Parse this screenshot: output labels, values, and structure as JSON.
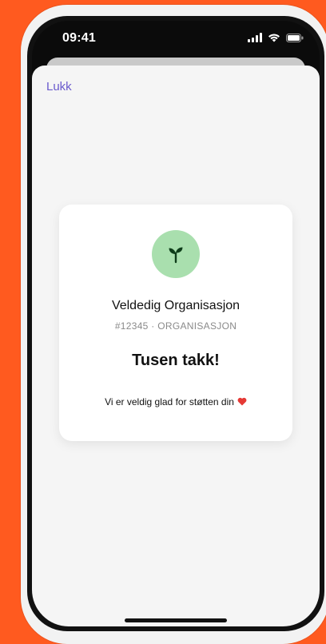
{
  "status": {
    "time": "09:41"
  },
  "nav": {
    "close_label": "Lukk"
  },
  "card": {
    "org_name": "Veldedig Organisasjon",
    "org_meta": "#12345 · ORGANISASJON",
    "title": "Tusen takk!",
    "message": "Vi er veldig glad for støtten din"
  },
  "icons": {
    "avatar": "sprout-icon",
    "message_suffix": "heart-icon"
  },
  "colors": {
    "background": "#ff5a1f",
    "link": "#6a5acd",
    "avatar_bg": "#a9dfae",
    "heart": "#e53935"
  }
}
